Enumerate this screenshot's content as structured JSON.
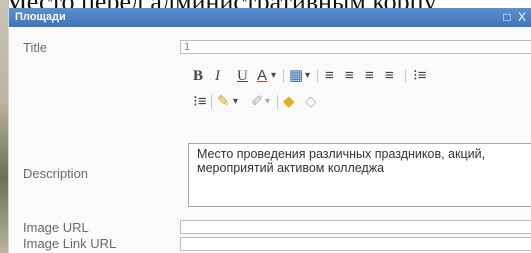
{
  "page_heading": "Место перед административным корпу",
  "dialog": {
    "title": "Площади",
    "controls": "□ X"
  },
  "fields": {
    "title_label": "Title",
    "title_value": "1",
    "description_label": "Description",
    "description_text": "Место проведения различных праздников, акций, мероприятий активом колледжа",
    "image_url_label": "Image URL",
    "image_url_value": "",
    "image_link_url_label": "Image Link URL",
    "image_link_url_value": ""
  },
  "toolbar": {
    "bold": "B",
    "italic": "I",
    "underline": "U",
    "font_color": "A",
    "dropdown": "▾",
    "highlight": "▦",
    "align_left": "≡",
    "align_center": "≡",
    "align_right": "≡",
    "justify": "≡",
    "bullet_list": "⁝≡",
    "numbered_list": "⁝≡",
    "insert_link": "✎",
    "remove_link": "✐",
    "insert_image": "◆",
    "remove_format": "◇"
  }
}
